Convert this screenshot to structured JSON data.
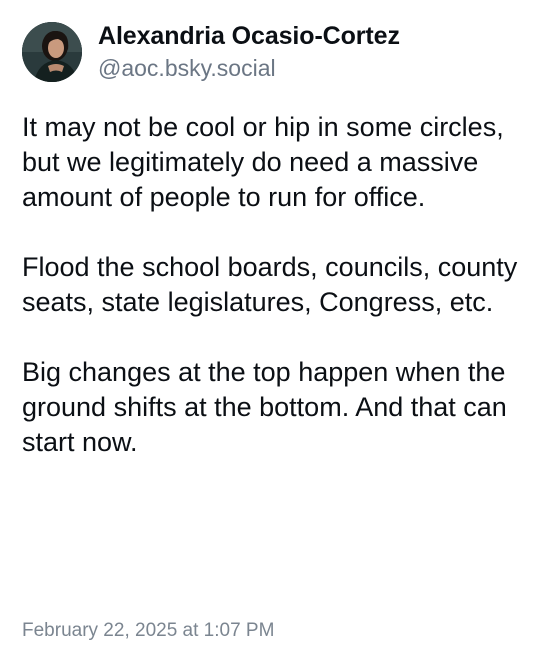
{
  "post": {
    "author": {
      "display_name": "Alexandria Ocasio-Cortez",
      "handle": "@aoc.bsky.social",
      "avatar_icon": "profile-photo"
    },
    "paragraphs": [
      "It may not be cool or hip in some circles, but we legitimately do need a massive amount of people to run for office.",
      "Flood the school boards, councils, county seats, state legislatures, Congress, etc.",
      "Big changes at the top happen when the ground shifts at the bottom. And that can start now."
    ],
    "timestamp": "February 22, 2025 at 1:07 PM"
  },
  "colors": {
    "text": "#0b0f14",
    "muted": "#6b7684",
    "background": "#ffffff"
  }
}
